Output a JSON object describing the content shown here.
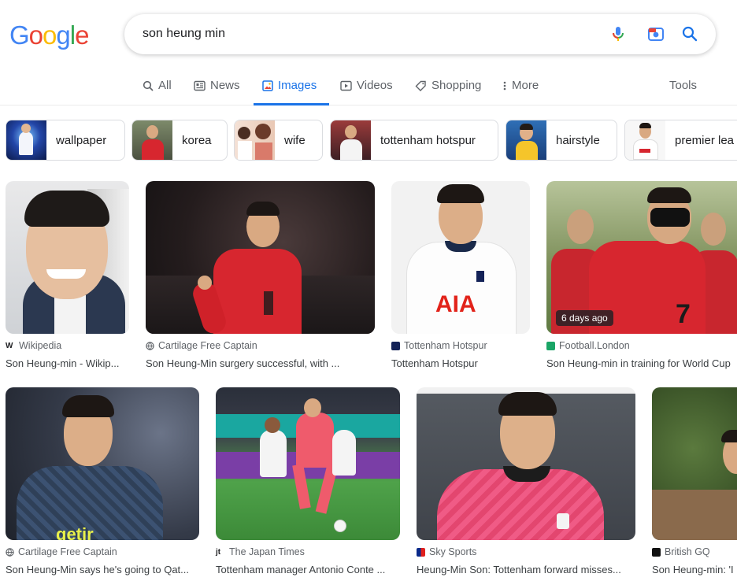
{
  "logo": {
    "letters": [
      "G",
      "o",
      "o",
      "g",
      "l",
      "e"
    ],
    "colors": [
      "#4285F4",
      "#EA4335",
      "#FBBC05",
      "#4285F4",
      "#34A853",
      "#EA4335"
    ]
  },
  "search": {
    "query": "son heung min",
    "icons": [
      "mic-icon",
      "camera-lens-icon",
      "search-icon"
    ]
  },
  "tabs": [
    {
      "label": "All",
      "icon": "search-icon"
    },
    {
      "label": "News",
      "icon": "news-icon"
    },
    {
      "label": "Images",
      "icon": "image-icon",
      "active": true
    },
    {
      "label": "Videos",
      "icon": "play-icon"
    },
    {
      "label": "Shopping",
      "icon": "tag-icon"
    },
    {
      "label": "More",
      "icon": "dots-vertical-icon"
    }
  ],
  "tools_label": "Tools",
  "chips": [
    {
      "label": "wallpaper"
    },
    {
      "label": "korea"
    },
    {
      "label": "wife"
    },
    {
      "label": "tottenham hotspur"
    },
    {
      "label": "hairstyle"
    },
    {
      "label": "premier lea"
    }
  ],
  "results": [
    {
      "source": "Wikipedia",
      "title": "Son Heung-min - Wikip..."
    },
    {
      "source": "Cartilage Free Captain",
      "title": "Son Heung-Min surgery successful, with ..."
    },
    {
      "source": "Tottenham Hotspur",
      "title": "Tottenham Hotspur"
    },
    {
      "source": "Football.London",
      "title": "Son Heung-min in training for World Cup",
      "badge": "6 days ago"
    },
    {
      "source": "Cartilage Free Captain",
      "title": "Son Heung-Min says he's going to Qat..."
    },
    {
      "source": "The Japan Times",
      "title": "Tottenham manager Antonio Conte ..."
    },
    {
      "source": "Sky Sports",
      "title": "Heung-Min Son: Tottenham forward misses..."
    },
    {
      "source": "British GQ",
      "title": "Son Heung-min: 'I"
    }
  ],
  "colors": {
    "accent": "#1a73e8",
    "korea_red": "#d7262f",
    "spurs_navy": "#132257"
  }
}
